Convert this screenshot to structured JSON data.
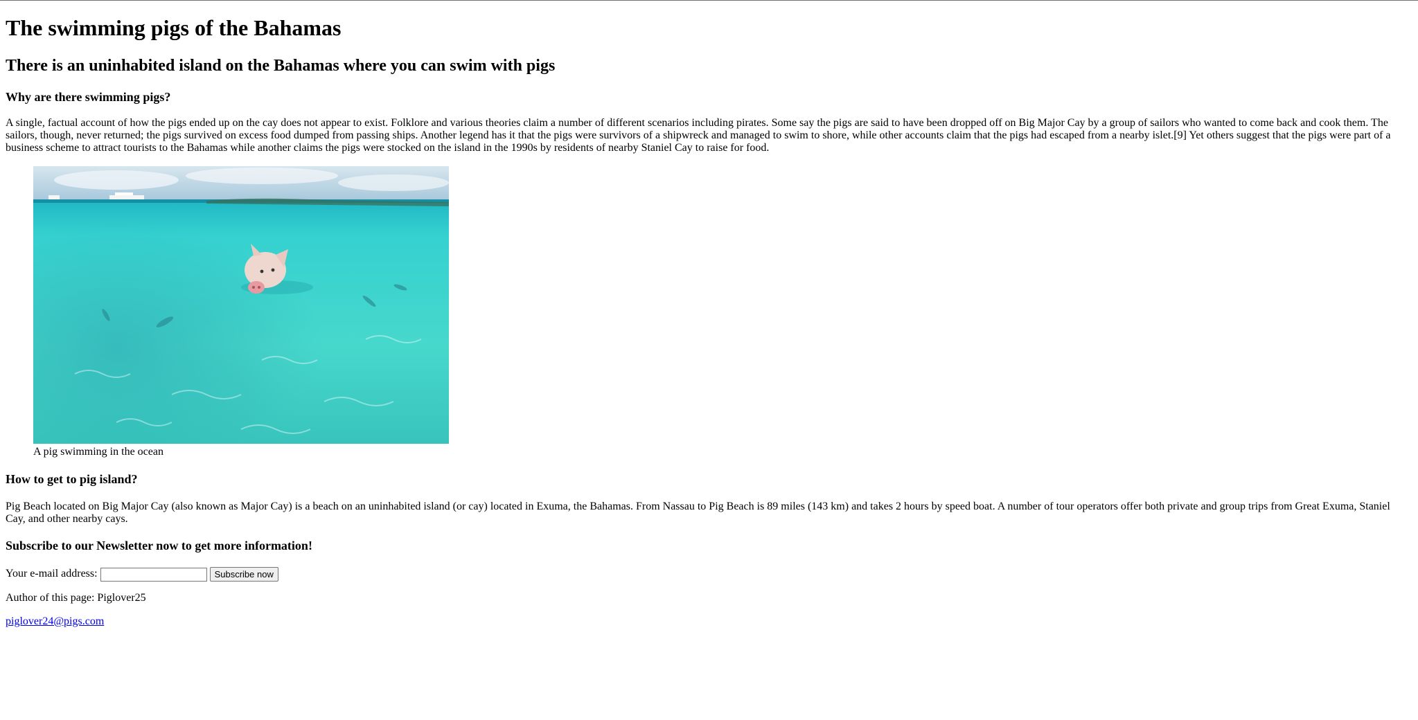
{
  "page": {
    "title": "The swimming pigs of the Bahamas",
    "subtitle": "There is an uninhabited island on the Bahamas where you can swim with pigs"
  },
  "sections": {
    "why": {
      "heading": "Why are there swimming pigs?",
      "text": "A single, factual account of how the pigs ended up on the cay does not appear to exist. Folklore and various theories claim a number of different scenarios including pirates. Some say the pigs are said to have been dropped off on Big Major Cay by a group of sailors who wanted to come back and cook them. The sailors, though, never returned; the pigs survived on excess food dumped from passing ships. Another legend has it that the pigs were survivors of a shipwreck and managed to swim to shore, while other accounts claim that the pigs had escaped from a nearby islet.[9] Yet others suggest that the pigs were part of a business scheme to attract tourists to the Bahamas while another claims the pigs were stocked on the island in the 1990s by residents of nearby Staniel Cay to raise for food."
    },
    "figure": {
      "caption": "A pig swimming in the ocean"
    },
    "how": {
      "heading": "How to get to pig island?",
      "text": "Pig Beach located on Big Major Cay (also known as Major Cay) is a beach on an uninhabited island (or cay) located in Exuma, the Bahamas. From Nassau to Pig Beach is 89 miles (143 km) and takes 2 hours by speed boat. A number of tour operators offer both private and group trips from Great Exuma, Staniel Cay, and other nearby cays."
    },
    "subscribe": {
      "heading": "Subscribe to our Newsletter now to get more information!",
      "label": "Your e-mail address:",
      "input_value": "",
      "button_label": "Subscribe now"
    }
  },
  "footer": {
    "author": "Author of this page: Piglover25",
    "email": "piglover24@pigs.com"
  }
}
